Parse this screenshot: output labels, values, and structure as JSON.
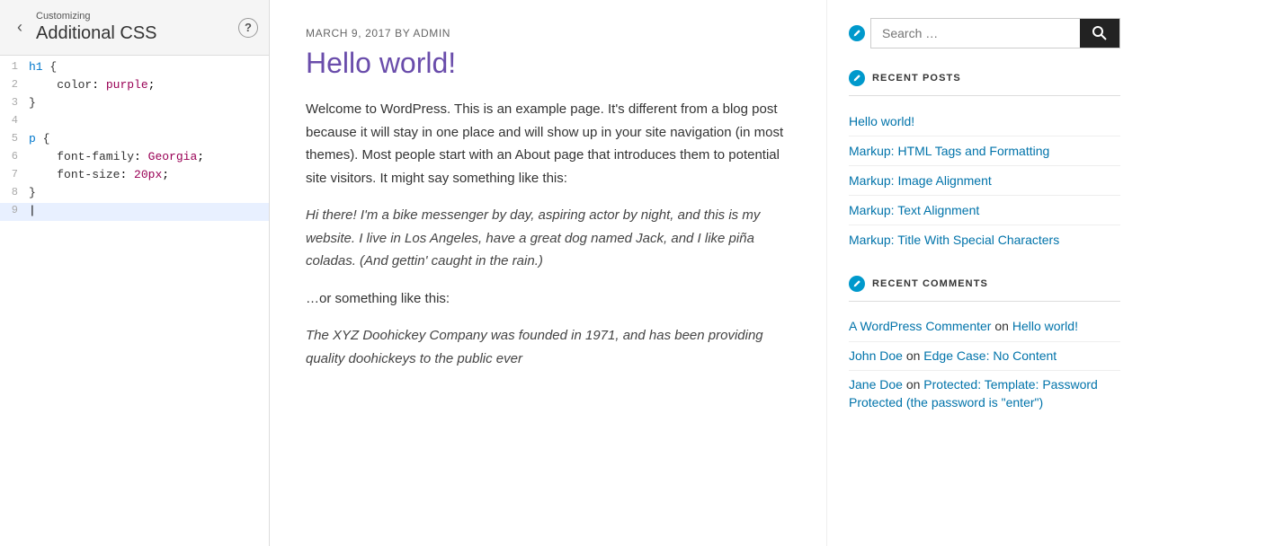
{
  "panel": {
    "customizing_label": "Customizing",
    "title": "Additional CSS",
    "help_label": "?",
    "back_label": "‹"
  },
  "code_editor": {
    "lines": [
      {
        "number": "1",
        "content": "h1 {",
        "type": "selector"
      },
      {
        "number": "2",
        "content": "    color: purple;",
        "type": "property"
      },
      {
        "number": "3",
        "content": "}",
        "type": "brace"
      },
      {
        "number": "4",
        "content": "",
        "type": "empty"
      },
      {
        "number": "5",
        "content": "p {",
        "type": "selector"
      },
      {
        "number": "6",
        "content": "    font-family: Georgia;",
        "type": "property"
      },
      {
        "number": "7",
        "content": "    font-size: 20px;",
        "type": "property"
      },
      {
        "number": "8",
        "content": "}",
        "type": "brace"
      },
      {
        "number": "9",
        "content": "",
        "type": "active"
      }
    ]
  },
  "post": {
    "meta": "March 9, 2017 by Admin",
    "title": "Hello world!",
    "paragraphs": [
      {
        "text": "Welcome to WordPress. This is an example page. It's different from a blog post because it will stay in one place and will show up in your site navigation (in most themes). Most people start with an About page that introduces them to potential site visitors. It might say something like this:",
        "italic": false
      },
      {
        "text": "Hi there! I'm a bike messenger by day, aspiring actor by night, and this is my website. I live in Los Angeles, have a great dog named Jack, and I like piña coladas. (And gettin' caught in the rain.)",
        "italic": true
      },
      {
        "text": "…or something like this:",
        "italic": false
      },
      {
        "text": "The XYZ Doohickey Company was founded in 1971, and has been providing quality doohickeys to the public ever",
        "italic": true
      }
    ]
  },
  "sidebar": {
    "search": {
      "placeholder": "Search …",
      "button_label": "Search"
    },
    "recent_posts": {
      "title": "Recent Posts",
      "items": [
        {
          "label": "Hello world!"
        },
        {
          "label": "Markup: HTML Tags and Formatting"
        },
        {
          "label": "Markup: Image Alignment"
        },
        {
          "label": "Markup: Text Alignment"
        },
        {
          "label": "Markup: Title With Special Characters"
        }
      ]
    },
    "recent_comments": {
      "title": "Recent Comments",
      "items": [
        {
          "author": "A WordPress Commenter",
          "on": "on",
          "post": "Hello world!"
        },
        {
          "author": "John Doe",
          "on": "on",
          "post": "Edge Case: No Content"
        },
        {
          "author": "Jane Doe",
          "on": "on",
          "post": "Protected: Template: Password Protected (the password is \"enter\")"
        }
      ]
    }
  },
  "colors": {
    "accent": "#6a4dab",
    "link": "#0073aa",
    "teal": "#0099cc"
  }
}
